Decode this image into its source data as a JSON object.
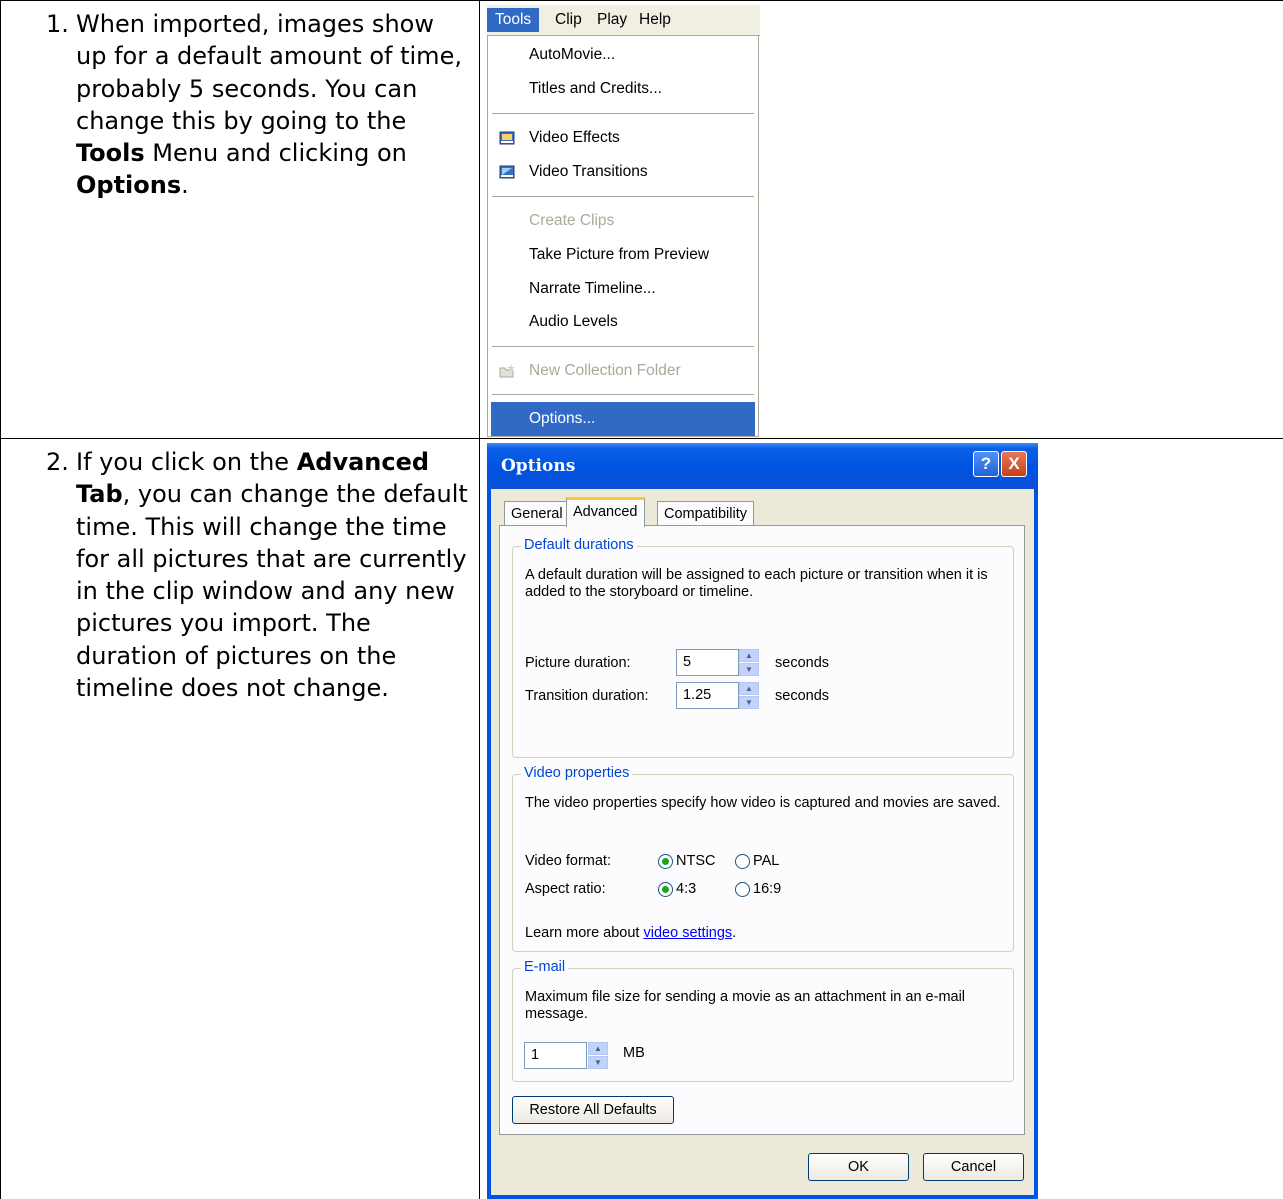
{
  "steps": [
    {
      "number": "1.",
      "text_parts": [
        "When imported, images show up for a default amount of time, probably 5 seconds. You can change this by going to the ",
        "Tools",
        " Menu and clicking on ",
        "Options",
        "."
      ]
    },
    {
      "number": "2.",
      "text_parts": [
        "If you click on the ",
        "Advanced Tab",
        ", you can change the default time. This will change the time for all pictures that are currently in the clip window and any new pictures you import. The duration of pictures on the timeline does not change."
      ]
    }
  ],
  "menu": {
    "bar": [
      "Tools",
      "Clip",
      "Play",
      "Help"
    ],
    "items": [
      "AutoMovie...",
      "Titles and Credits...",
      "Video Effects",
      "Video Transitions",
      "Create Clips",
      "Take Picture from Preview",
      "Narrate Timeline...",
      "Audio Levels",
      "New Collection Folder",
      "Options..."
    ]
  },
  "dialog": {
    "title": "Options",
    "help_button": "?",
    "close_button": "X",
    "tabs": [
      "General",
      "Advanced",
      "Compatibility"
    ],
    "active_tab": "Advanced",
    "durations": {
      "group_title": "Default durations",
      "description": "A default duration will be assigned to each picture or transition when it is added to the storyboard or timeline.",
      "picture_label": "Picture duration:",
      "picture_value": "5",
      "transition_label": "Transition duration:",
      "transition_value": "1.25",
      "unit": "seconds"
    },
    "video": {
      "group_title": "Video properties",
      "description": "The video properties specify how video is captured and movies are saved.",
      "format_label": "Video format:",
      "format_options": [
        "NTSC",
        "PAL"
      ],
      "format_selected": "NTSC",
      "aspect_label": "Aspect ratio:",
      "aspect_options": [
        "4:3",
        "16:9"
      ],
      "aspect_selected": "4:3",
      "learn_more_prefix": "Learn more about ",
      "learn_more_link": "video settings",
      "learn_more_suffix": "."
    },
    "email": {
      "group_title": "E-mail",
      "description": "Maximum file size for sending a movie as an attachment in an e-mail message.",
      "value": "1",
      "unit": "MB"
    },
    "restore_button": "Restore All Defaults",
    "ok_button": "OK",
    "cancel_button": "Cancel"
  }
}
